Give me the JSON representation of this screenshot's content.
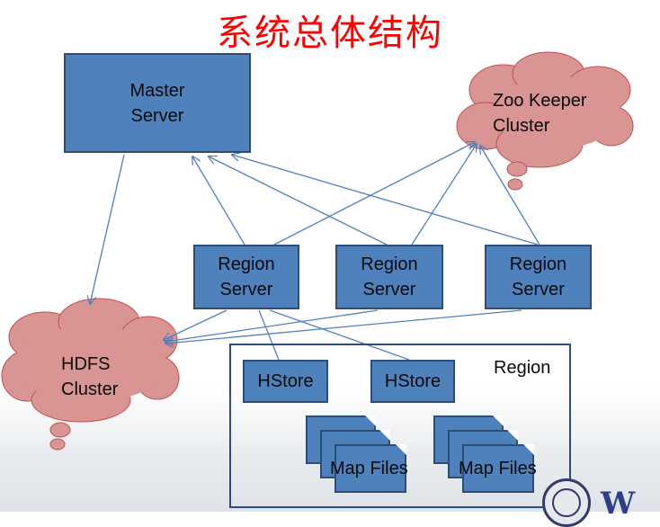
{
  "title": "系统总体结构",
  "nodes": {
    "master": {
      "line1": "Master",
      "line2": "Server"
    },
    "zookeeper": {
      "line1": "Zoo Keeper",
      "line2": "Cluster"
    },
    "hdfs": {
      "line1": "HDFS",
      "line2": "Cluster"
    },
    "region_servers": [
      {
        "line1": "Region",
        "line2": "Server"
      },
      {
        "line1": "Region",
        "line2": "Server"
      },
      {
        "line1": "Region",
        "line2": "Server"
      }
    ],
    "region": {
      "label": "Region",
      "hstores": [
        "HStore",
        "HStore"
      ],
      "map_files": [
        "Map Files",
        "Map Files"
      ]
    }
  },
  "colors": {
    "title": "#ff0000",
    "box_fill": "#4f81bd",
    "box_border": "#2c4d75",
    "cloud_fill": "#d99594",
    "arrow": "#4f81bd"
  }
}
